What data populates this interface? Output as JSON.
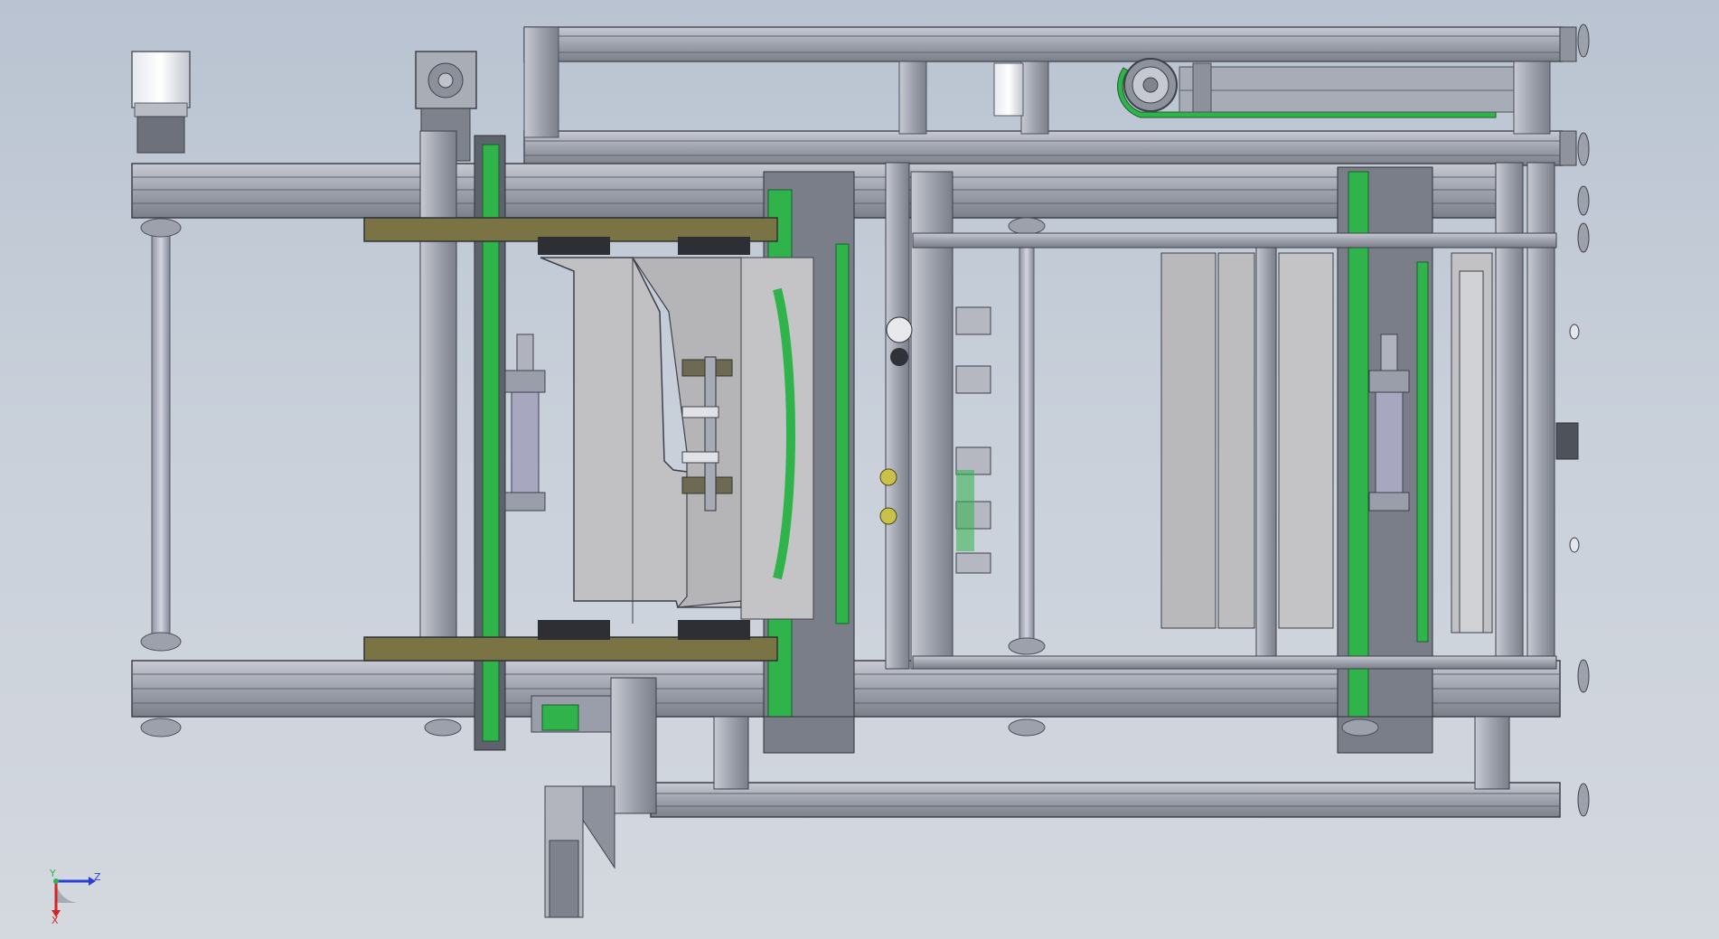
{
  "viewport": {
    "background_top": "#b9c3d1",
    "background_bottom": "#d4d8df"
  },
  "model": {
    "frame_color": "#a7abb6",
    "frame_dark": "#6f7480",
    "belt_color": "#2fb34a",
    "plate_color": "#7a7444",
    "panel_color": "#c4c4c6",
    "brass_color": "#c9c24a"
  },
  "triad": {
    "z_label": "Z",
    "y_label": "Y",
    "x_label": "X",
    "z_color": "#2b3fd6",
    "y_color": "#2bb44a",
    "x_color": "#d12626"
  }
}
